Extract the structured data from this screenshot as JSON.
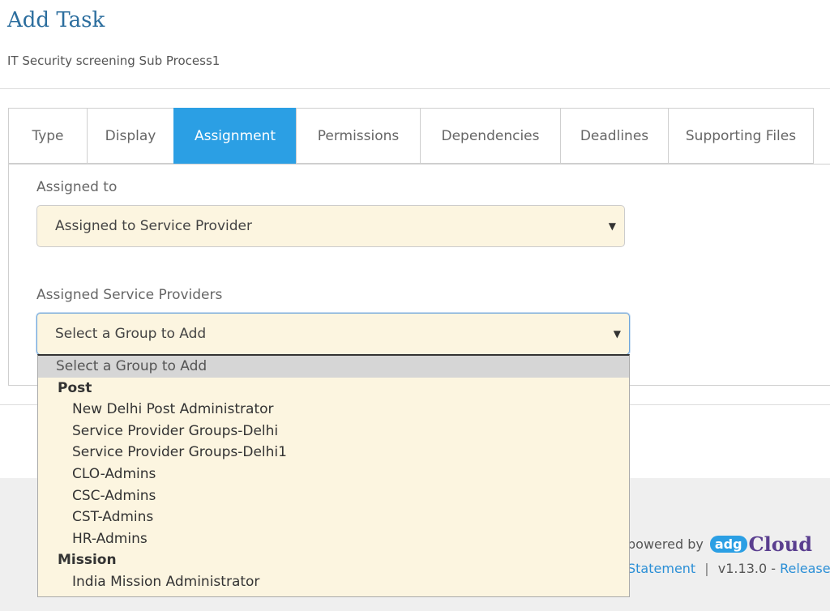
{
  "page": {
    "title": "Add Task",
    "subtitle": "IT Security screening Sub Process1"
  },
  "tabs": [
    {
      "label": "Type",
      "active": false
    },
    {
      "label": "Display",
      "active": false
    },
    {
      "label": "Assignment",
      "active": true
    },
    {
      "label": "Permissions",
      "active": false
    },
    {
      "label": "Dependencies",
      "active": false
    },
    {
      "label": "Deadlines",
      "active": false
    },
    {
      "label": "Supporting Files",
      "active": false
    }
  ],
  "form": {
    "assigned_to": {
      "label": "Assigned to",
      "value": "Assigned to Service Provider"
    },
    "assigned_service_providers": {
      "label": "Assigned Service Providers",
      "value": "Select a Group to Add"
    }
  },
  "dropdown": {
    "placeholder": "Select a Group to Add",
    "groups": [
      {
        "name": "Post",
        "options": [
          "New Delhi Post Administrator",
          "Service Provider Groups-Delhi",
          "Service Provider Groups-Delhi1",
          "CLO-Admins",
          "CSC-Admins",
          "CST-Admins",
          "HR-Admins"
        ]
      },
      {
        "name": "Mission",
        "options": [
          "India Mission Administrator"
        ]
      }
    ]
  },
  "footer": {
    "powered_by": "powered by",
    "logo_badge": "adg",
    "logo_word": "Cloud",
    "statement_link": "Statement",
    "separator": "|",
    "version": "v1.13.0 -",
    "release_link": "Release"
  },
  "colors": {
    "accent": "#2b9fe4",
    "select_bg": "#fcf5e0",
    "title": "#2c6e9e"
  }
}
